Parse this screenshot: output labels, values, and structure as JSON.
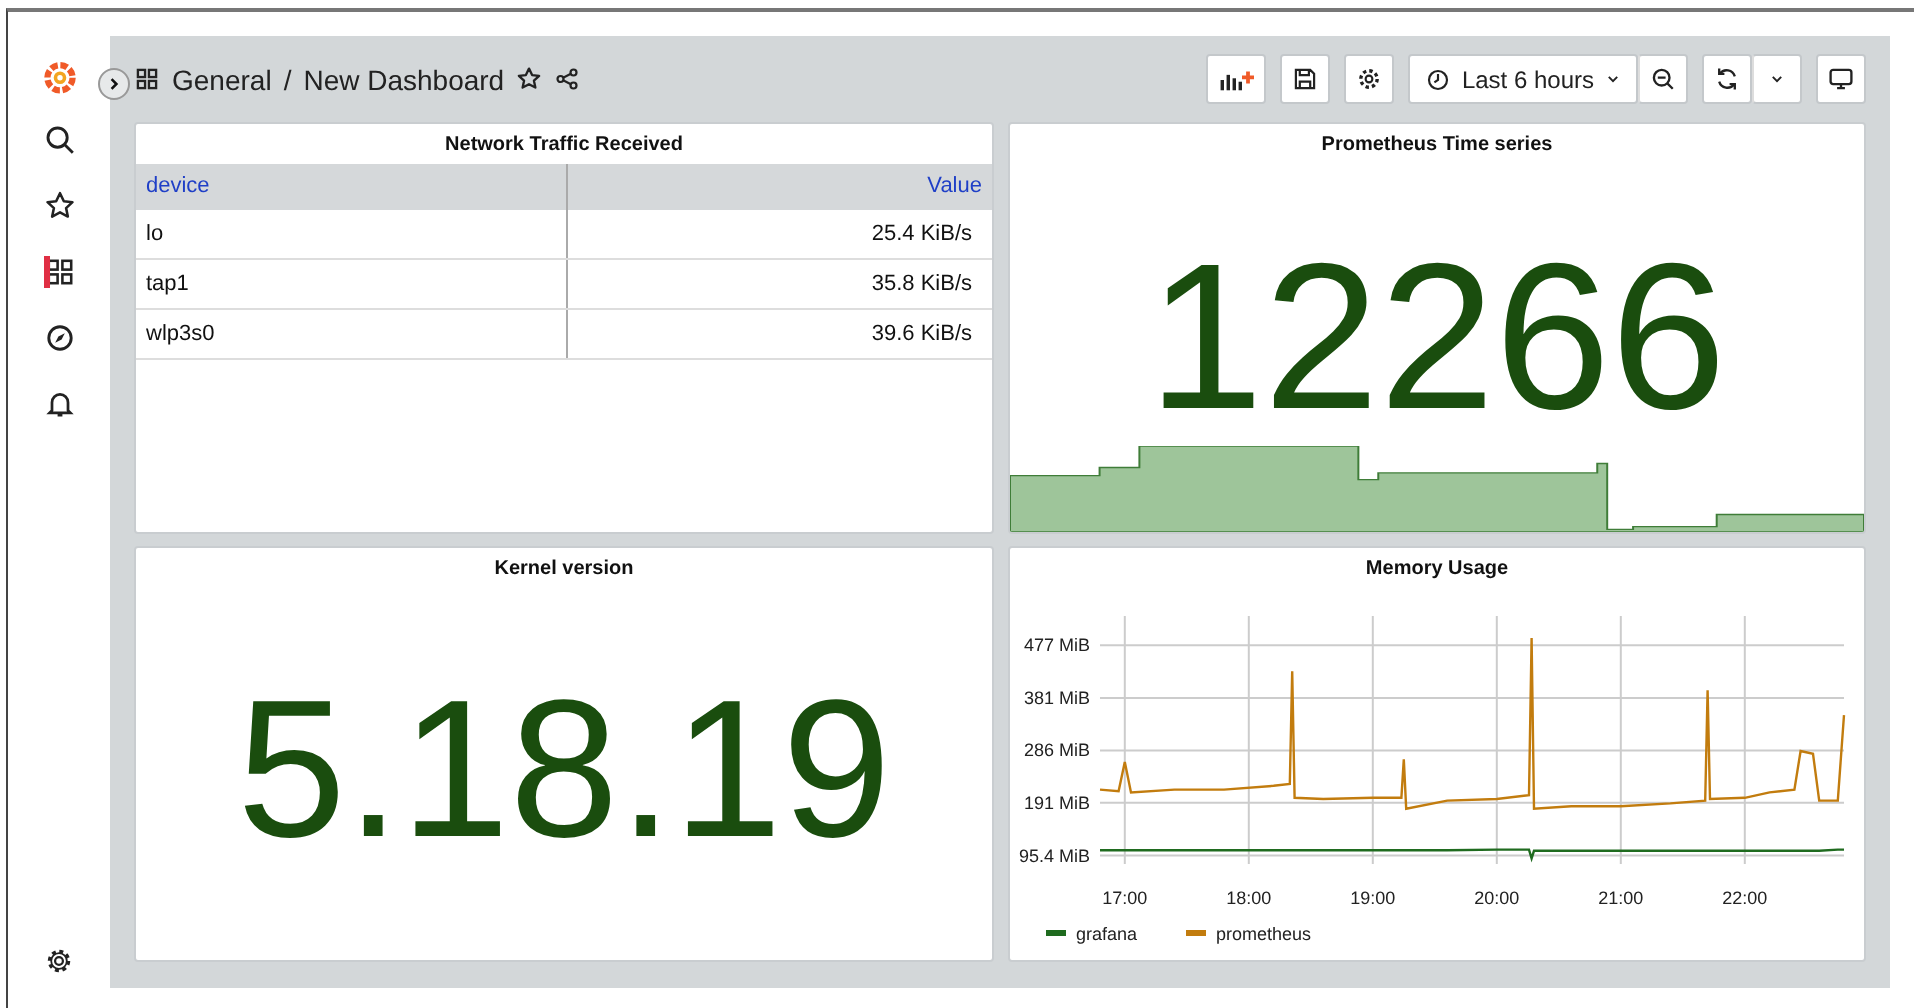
{
  "sidebar": {
    "items": [
      {
        "selected": false
      },
      {
        "selected": false
      },
      {
        "selected": true
      },
      {
        "selected": false
      },
      {
        "selected": false
      }
    ]
  },
  "breadcrumb": {
    "folder": "General",
    "separator": "/",
    "title": "New Dashboard"
  },
  "time_picker": {
    "label": "Last 6 hours"
  },
  "panels": [
    {
      "kind": "table",
      "title": "Network Traffic Received",
      "columns": [
        "device",
        "Value"
      ],
      "rows": [
        [
          "lo",
          "25.4 KiB/s"
        ],
        [
          "tap1",
          "35.8 KiB/s"
        ],
        [
          "wlp3s0",
          "39.6 KiB/s"
        ]
      ]
    },
    {
      "kind": "stat",
      "title": "Prometheus Time series",
      "value": "12266",
      "sparkline": true
    },
    {
      "kind": "stat",
      "title": "Kernel version",
      "value": "5.18.19",
      "sparkline": false
    },
    {
      "kind": "chart",
      "title": "Memory Usage",
      "chart_data": {
        "type": "line",
        "x": [
          16.8,
          16.95,
          17.0,
          17.05,
          17.4,
          17.8,
          18.2,
          18.33,
          18.35,
          18.37,
          18.6,
          19.0,
          19.23,
          19.25,
          19.27,
          19.6,
          20.0,
          20.26,
          20.28,
          20.3,
          20.6,
          21.0,
          21.4,
          21.68,
          21.7,
          21.72,
          22.0,
          22.2,
          22.4,
          22.45,
          22.55,
          22.6,
          22.75,
          22.8
        ],
        "series": [
          {
            "name": "grafana",
            "color": "#1f6b1f",
            "values": [
              105,
              105,
              105,
              105,
              105,
              105,
              105,
              105,
              105,
              105,
              105,
              105,
              105,
              105,
              105,
              105,
              106,
              106,
              90,
              104,
              104,
              104,
              104,
              104,
              104,
              104,
              104,
              104,
              104,
              104,
              104,
              104,
              106,
              106
            ]
          },
          {
            "name": "prometheus",
            "color": "#c27c0e",
            "values": [
              215,
              212,
              265,
              210,
              215,
              215,
              222,
              225,
              430,
              200,
              198,
              200,
              200,
              270,
              180,
              195,
              198,
              205,
              490,
              180,
              185,
              185,
              190,
              195,
              395,
              198,
              200,
              210,
              215,
              285,
              280,
              195,
              195,
              350
            ]
          }
        ],
        "grid": true,
        "legend": true,
        "xlim": [
          16.8,
          22.8
        ],
        "ylim": [
          80,
          530
        ],
        "xticks": [
          {
            "value": 17,
            "label": "17:00"
          },
          {
            "value": 18,
            "label": "18:00"
          },
          {
            "value": 19,
            "label": "19:00"
          },
          {
            "value": 20,
            "label": "20:00"
          },
          {
            "value": 21,
            "label": "21:00"
          },
          {
            "value": 22,
            "label": "22:00"
          }
        ],
        "yticks": [
          {
            "value": 95.4,
            "label": "95.4 MiB"
          },
          {
            "value": 191,
            "label": "191 MiB"
          },
          {
            "value": 286,
            "label": "286 MiB"
          },
          {
            "value": 381,
            "label": "381 MiB"
          },
          {
            "value": 477,
            "label": "477 MiB"
          }
        ]
      }
    }
  ]
}
